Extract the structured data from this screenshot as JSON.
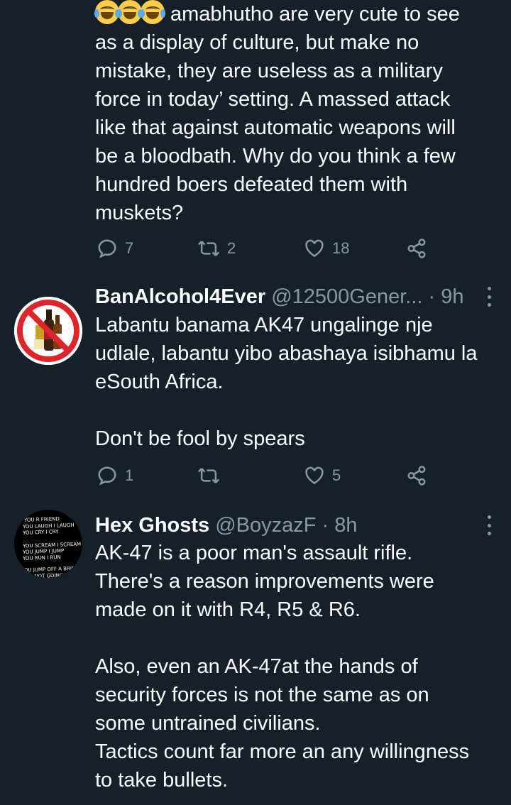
{
  "tweet1": {
    "text": "amabhutho are very cute to see\nas a display of culture, but make no\nmistake, they are useless as a military\nforce in today’ setting. A massed attack\nlike that against automatic weapons will\nbe a bloodbath. Why do you think a few\nhundred boers defeated them with\nmuskets?",
    "emoji": [
      "face-with-tears-of-joy",
      "face-with-tears-of-joy",
      "face-with-tears-of-joy"
    ],
    "replies": "7",
    "retweets": "2",
    "likes": "18"
  },
  "tweet2": {
    "name": "BanAlcohol4Ever",
    "handle": "@12500Gener...",
    "sep": " · ",
    "time": "9h",
    "text": "Labantu banama AK47 ungalinge nje\nudlale, labantu yibo abashaya isibhamu la\neSouth Africa.\n\nDon't be fool by spears",
    "replies": "1",
    "retweets": "",
    "likes": "5",
    "avatar_icon": "no-alcohol-sign"
  },
  "tweet3": {
    "name": "Hex Ghosts",
    "handle": "@BoyzazF",
    "sep": " · ",
    "time": "8h",
    "text": "AK-47 is a poor man's assault rifle.\nThere's a reason improvements were\nmade on it with R4, R5 & R6.\n\nAlso, even an AK-47at the hands of\nsecurity forces is not the same as on\nsome untrained civilians.\nTactics count far more an any willingness\nto take bullets.",
    "avatar_lines": [
      "YOU R FRIEND",
      "YOU LAUGH I LAUGH",
      "YOU CRY I CRY",
      "YOU SCREAM I SCREAM",
      "YOU JUMP I JUMP",
      "YOU RUN I RUN",
      "YOU JUMP OFF A BRIDGE",
      "I'M NOT GOING TO MISS"
    ]
  },
  "colors": {
    "background": "#15202b",
    "text": "#ffffff",
    "muted": "#8899a6",
    "ban_red": "#e0242b"
  }
}
